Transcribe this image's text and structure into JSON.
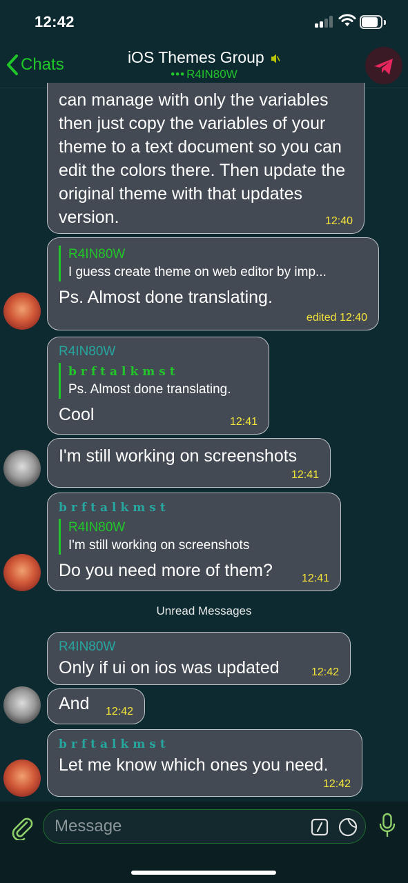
{
  "status_bar": {
    "time": "12:42"
  },
  "nav": {
    "back_label": "Chats",
    "title": "iOS Themes Group",
    "subtitle": "R4IN80W",
    "typing_dots": "•••"
  },
  "messages": [
    {
      "text": "can manage with only the variables then just copy the variables of your theme to a text document so you can edit the colors there. Then update the original theme with that updates version.",
      "time": "12:40"
    },
    {
      "reply_name": "R4IN80W",
      "reply_text": "I guess create theme on web editor by imp...",
      "text": "Ps. Almost done translating.",
      "time": "edited 12:40"
    },
    {
      "sender": "R4IN80W",
      "reply_name": "brftalkmst",
      "reply_text": "Ps. Almost done translating.",
      "text": "Cool",
      "time": "12:41"
    },
    {
      "text": "I'm still working on screenshots",
      "time": "12:41"
    },
    {
      "sender": "brftalkmst",
      "reply_name": "R4IN80W",
      "reply_text": "I'm still working on screenshots",
      "text": "Do you need more of them?",
      "time": "12:41"
    },
    {
      "sender": "R4IN80W",
      "text": "Only if ui on ios was updated",
      "time": "12:42"
    },
    {
      "text": "And",
      "time": "12:42"
    },
    {
      "sender": "brftalkmst",
      "text": "Let me know which ones you need.",
      "time": "12:42"
    }
  ],
  "unread_divider": "Unread Messages",
  "composer": {
    "placeholder": "Message"
  },
  "colors": {
    "background": "#0c2a30",
    "bubble": "#434a53",
    "accent_green": "#21c629",
    "sender_teal": "#27a6a0",
    "time_yellow": "#f4e43a"
  },
  "icons": [
    "back-chevron-icon",
    "mute-icon",
    "group-avatar",
    "paperclip-icon",
    "bot-command-icon",
    "sticker-icon",
    "microphone-icon"
  ]
}
